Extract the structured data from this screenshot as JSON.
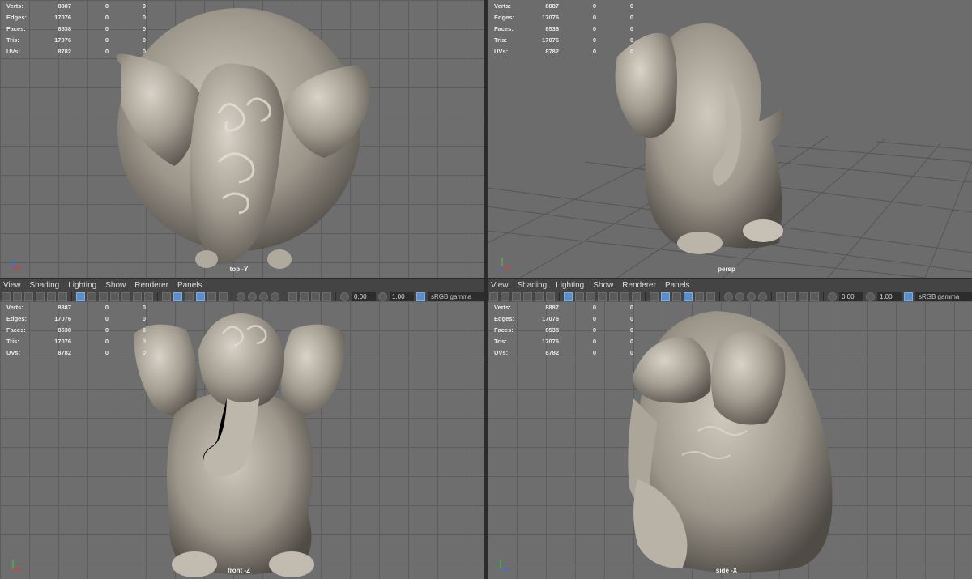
{
  "hud_labels": [
    "Verts:",
    "Edges:",
    "Faces:",
    "Tris:",
    "UVs:"
  ],
  "hud_values": [
    [
      "8887",
      "0",
      "0"
    ],
    [
      "17076",
      "0",
      "0"
    ],
    [
      "8538",
      "0",
      "0"
    ],
    [
      "17076",
      "0",
      "0"
    ],
    [
      "8782",
      "0",
      "0"
    ]
  ],
  "menus": [
    "View",
    "Shading",
    "Lighting",
    "Show",
    "Renderer",
    "Panels"
  ],
  "toolbar": {
    "exposure": "0.00",
    "gamma_value": "1.00",
    "color_space": "sRGB gamma"
  },
  "viewports": {
    "top": "top -Y",
    "persp": "persp",
    "front": "front -Z",
    "side": "side -X"
  },
  "colors": {
    "viewport_bg": "#6e6e6e",
    "grid": "#5d5d5d",
    "panel": "#444444",
    "active_tool": "#5b8ec9",
    "stone": "#a8a294"
  }
}
